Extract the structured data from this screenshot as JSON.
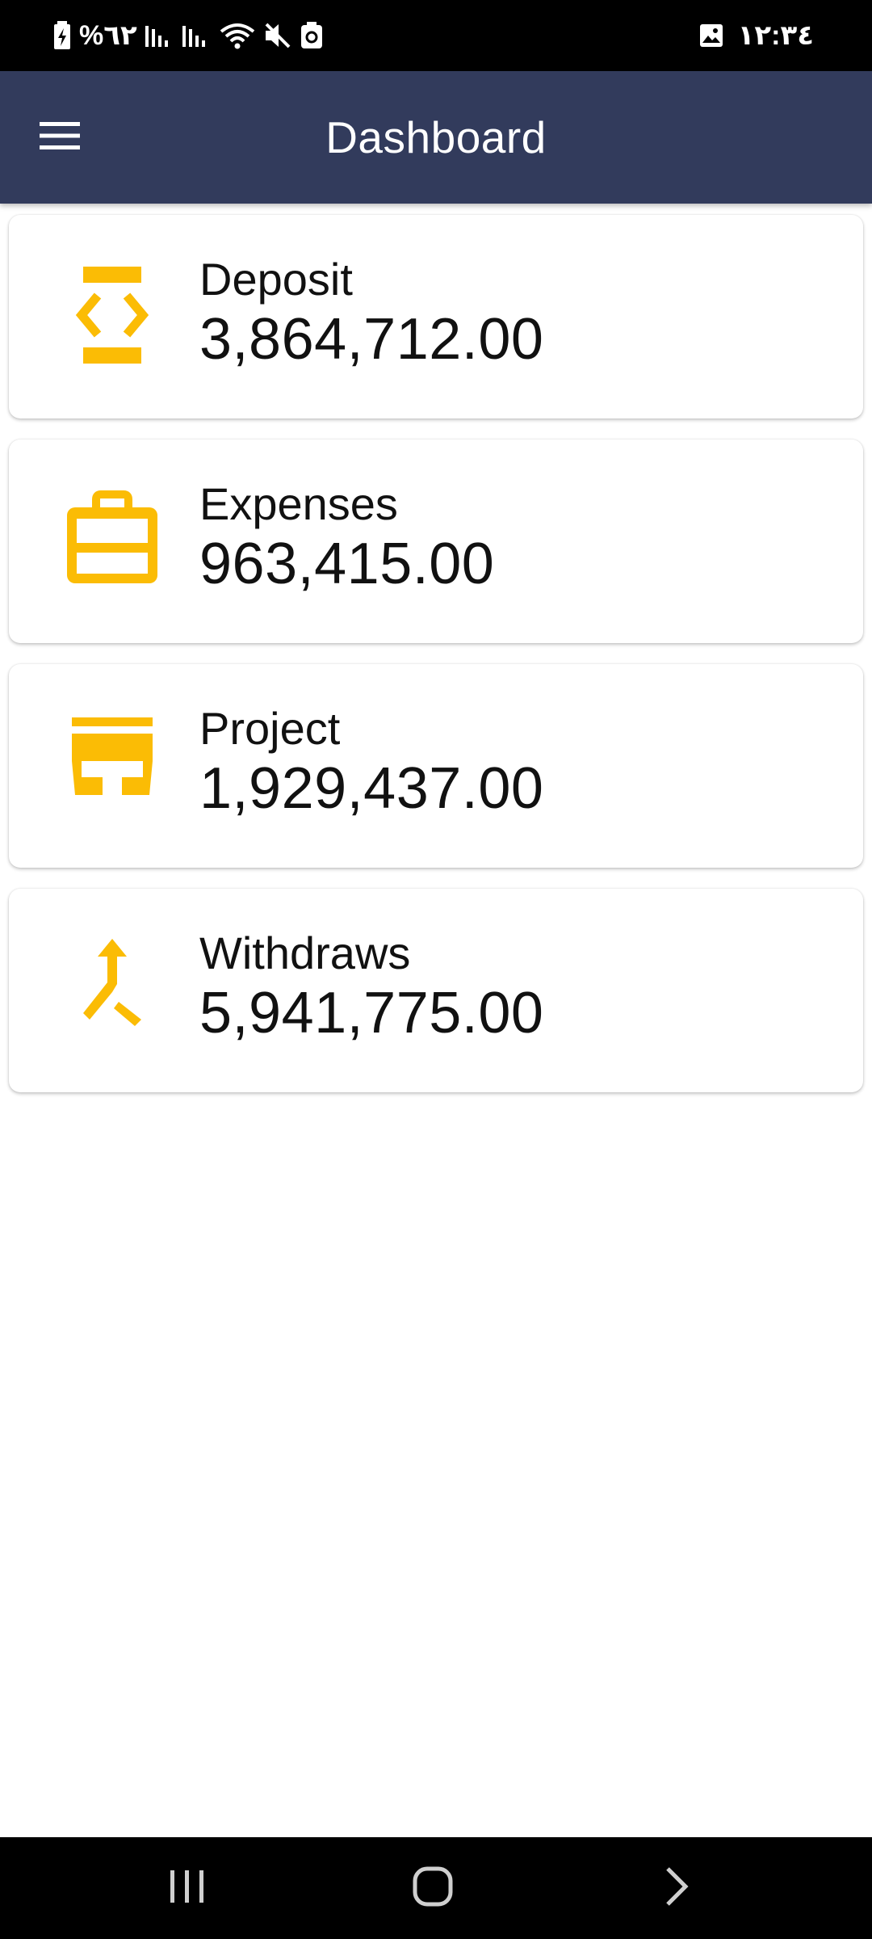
{
  "status_bar": {
    "battery": "%٦٢",
    "time": "١٢:٣٤"
  },
  "app_bar": {
    "title": "Dashboard",
    "menu_icon": "menu-icon",
    "background": "#323b5c"
  },
  "accent_color": "#fbbc05",
  "cards": [
    {
      "label": "Deposit",
      "value": "3,864,712.00",
      "icon": "deposit-icon"
    },
    {
      "label": "Expenses",
      "value": "963,415.00",
      "icon": "briefcase-icon"
    },
    {
      "label": "Project",
      "value": "1,929,437.00",
      "icon": "store-icon"
    },
    {
      "label": "Withdraws",
      "value": "5,941,775.00",
      "icon": "call-split-icon"
    }
  ],
  "nav_bar": {
    "recents_icon": "recents-icon",
    "home_icon": "home-icon",
    "back_icon": "back-icon"
  }
}
